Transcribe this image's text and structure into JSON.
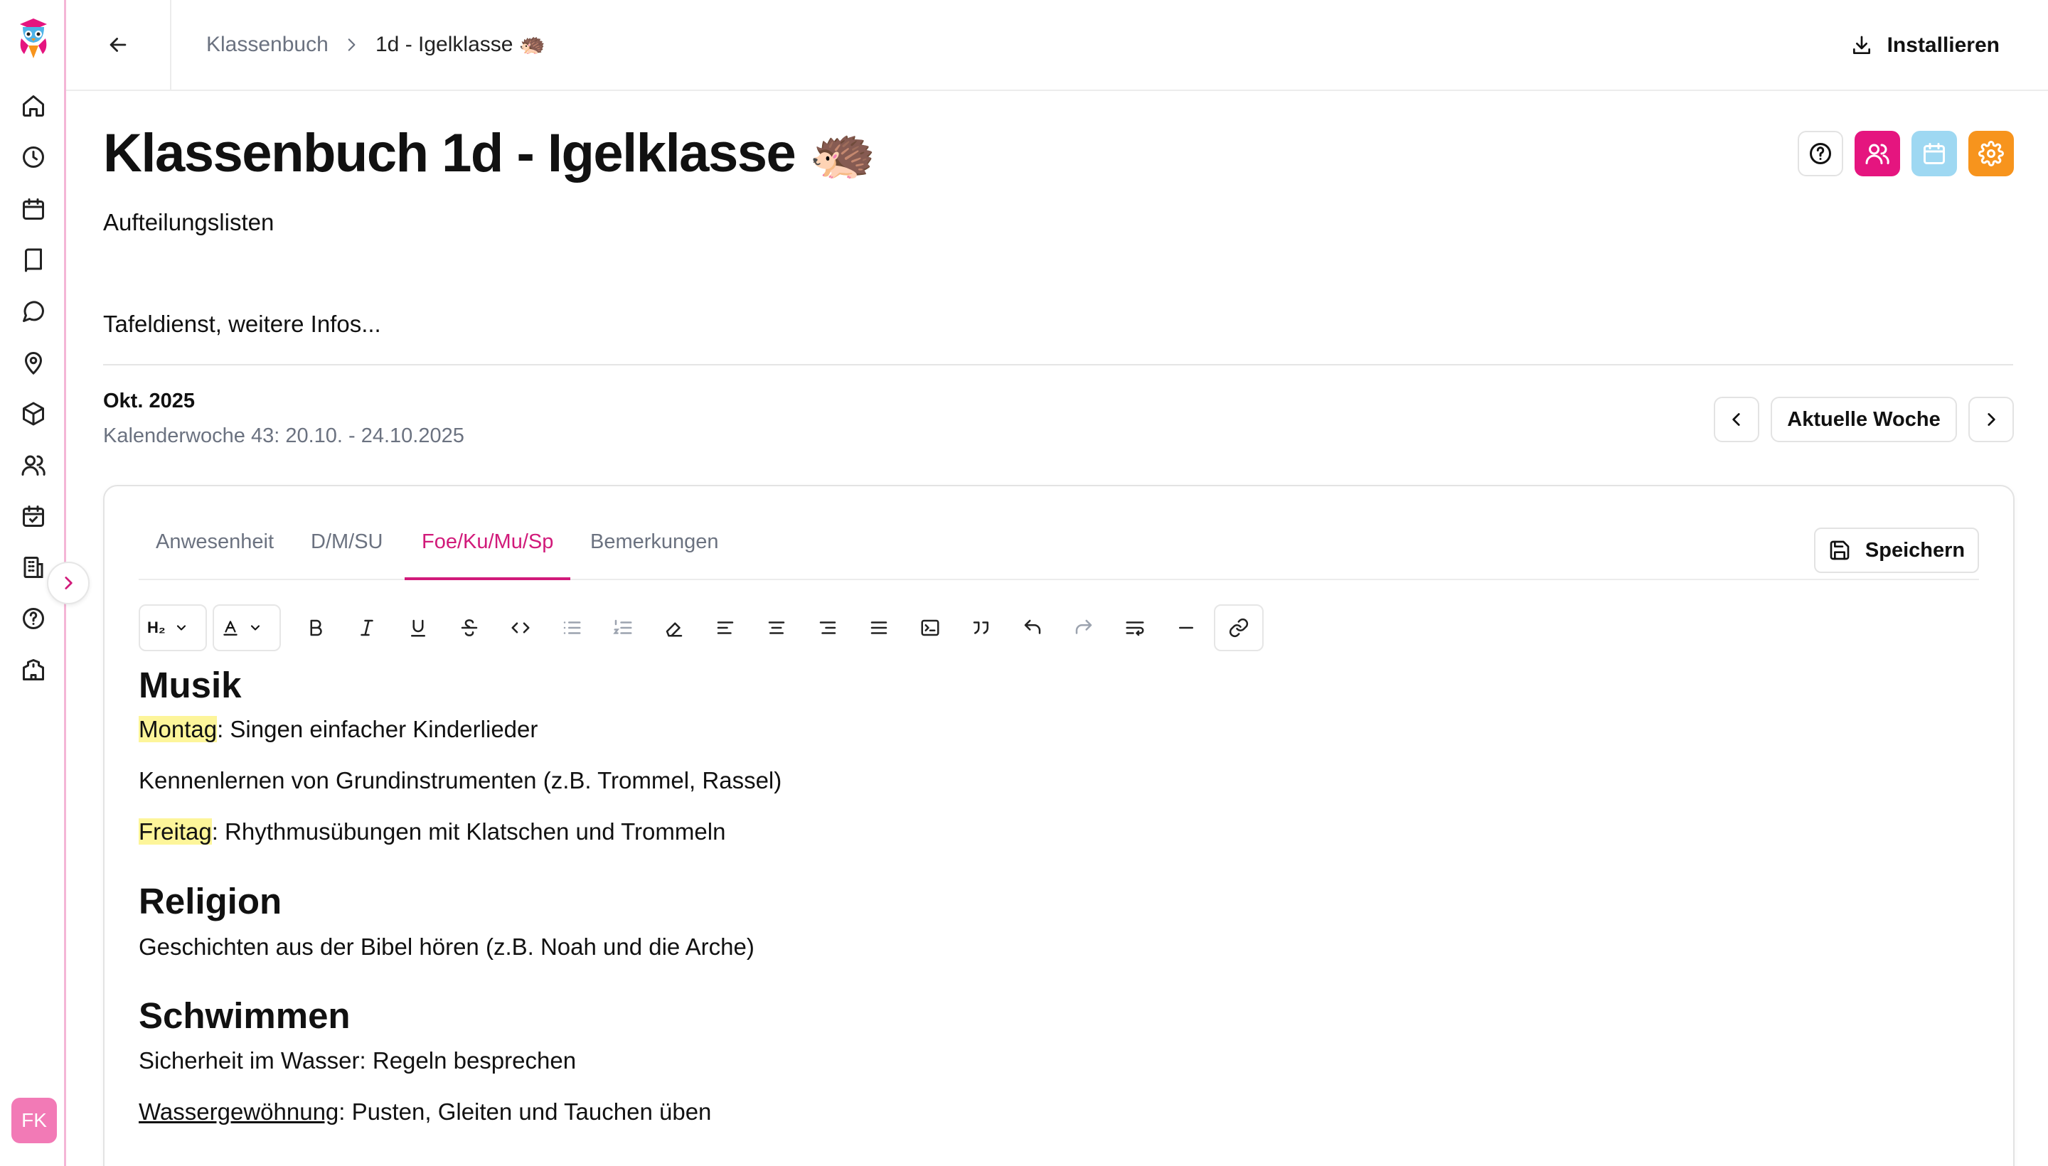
{
  "breadcrumb": {
    "root": "Klassenbuch",
    "current": "1d - Igelklasse 🦔"
  },
  "install_label": "Installieren",
  "page": {
    "title": "Klassenbuch 1d - Igelklasse 🦔",
    "description_1": "Aufteilungslisten",
    "description_2": "Tafeldienst, weitere Infos..."
  },
  "calendar": {
    "month": "Okt. 2025",
    "week": "Kalenderwoche 43: 20.10. - 24.10.2025",
    "current_week_label": "Aktuelle Woche"
  },
  "tabs": [
    "Anwesenheit",
    "D/M/SU",
    "Foe/Ku/Mu/Sp",
    "Bemerkungen"
  ],
  "active_tab": "Foe/Ku/Mu/Sp",
  "save_label": "Speichern",
  "toolbar": {
    "heading_select": "H₂",
    "text_color_select": "A"
  },
  "editor": {
    "musik_heading": "Musik",
    "montag_label": "Montag",
    "montag_text": ": Singen einfacher Kinderlieder",
    "line_2": "Kennenlernen von Grundinstrumenten (z.B. Trommel, Rassel)",
    "freitag_label": "Freitag",
    "freitag_text": ": Rhythmusübungen mit Klatschen und Trommeln",
    "religion_heading": "Religion",
    "religion_text": "Geschichten aus der Bibel hören (z.B. Noah und die Arche)",
    "schwimmen_heading": "Schwimmen",
    "schwimmen_text": "Sicherheit im Wasser: Regeln besprechen",
    "wasser_label": "Wassergewöhnung",
    "wasser_text": ": Pusten, Gleiten und Tauchen üben"
  },
  "user_initials": "FK",
  "colors": {
    "accent": "#d11a7a",
    "users_button": "#e5157f",
    "calendar_button": "#9ed8f2",
    "settings_button": "#f7941d",
    "highlight": "#fdf59a",
    "avatar": "#f27ab6"
  }
}
